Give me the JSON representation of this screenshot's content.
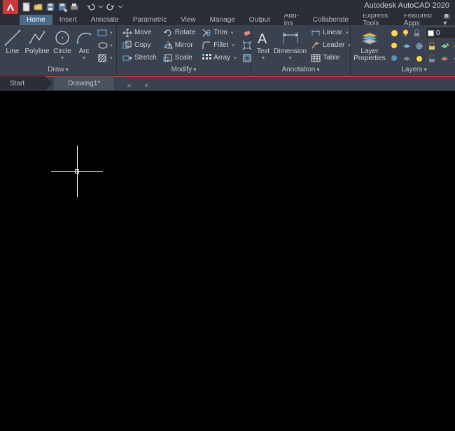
{
  "app_title": "Autodesk AutoCAD 2020",
  "menu": {
    "items": [
      "Home",
      "Insert",
      "Annotate",
      "Parametric",
      "View",
      "Manage",
      "Output",
      "Add-ins",
      "Collaborate",
      "Express Tools",
      "Featured Apps"
    ],
    "active": "Home"
  },
  "ribbon": {
    "draw": {
      "title": "Draw",
      "line": "Line",
      "polyline": "Polyline",
      "circle": "Circle",
      "arc": "Arc"
    },
    "modify": {
      "title": "Modify",
      "move": "Move",
      "copy": "Copy",
      "stretch": "Stretch",
      "rotate": "Rotate",
      "mirror": "Mirror",
      "scale": "Scale",
      "trim": "Trim",
      "fillet": "Fillet",
      "array": "Array"
    },
    "annotation": {
      "title": "Annotation",
      "text": "Text",
      "dimension": "Dimension",
      "linear": "Linear",
      "leader": "Leader",
      "table": "Table"
    },
    "layers": {
      "title": "Layers",
      "props": "Layer\nProperties",
      "current": "0"
    }
  },
  "tabs": {
    "start": "Start",
    "doc": "Drawing1*"
  }
}
